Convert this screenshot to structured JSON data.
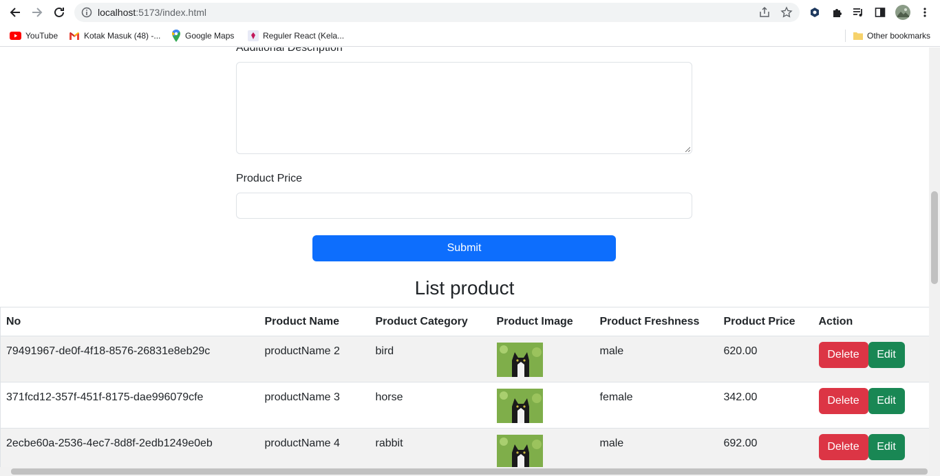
{
  "browser": {
    "url_host": "localhost",
    "url_rest": ":5173/index.html",
    "bookmarks": [
      {
        "label": "YouTube",
        "icon": "youtube-icon"
      },
      {
        "label": "Kotak Masuk (48) -...",
        "icon": "gmail-icon"
      },
      {
        "label": "Google Maps",
        "icon": "maps-icon"
      },
      {
        "label": "Reguler React (Kela...",
        "icon": "bookmark-favicon-icon"
      }
    ],
    "other_bookmarks": "Other bookmarks"
  },
  "form": {
    "description_label": "Additional Description",
    "price_label": "Product Price",
    "submit_label": "Submit"
  },
  "list": {
    "title": "List product",
    "headers": [
      "No",
      "Product Name",
      "Product Category",
      "Product Image",
      "Product Freshness",
      "Product Price",
      "Action"
    ],
    "rows": [
      {
        "id": "79491967-de0f-4f18-8576-26831e8eb29c",
        "name": "productName 2",
        "category": "bird",
        "freshness": "male",
        "price": "620.00"
      },
      {
        "id": "371fcd12-357f-451f-8175-dae996079cfe",
        "name": "productName 3",
        "category": "horse",
        "freshness": "female",
        "price": "342.00"
      },
      {
        "id": "2ecbe60a-2536-4ec7-8d8f-2edb1249e0eb",
        "name": "productName 4",
        "category": "rabbit",
        "freshness": "male",
        "price": "692.00"
      }
    ],
    "delete_label": "Delete",
    "edit_label": "Edit"
  },
  "colors": {
    "primary": "#0d6efd",
    "danger": "#dc3545",
    "success": "#198754"
  }
}
